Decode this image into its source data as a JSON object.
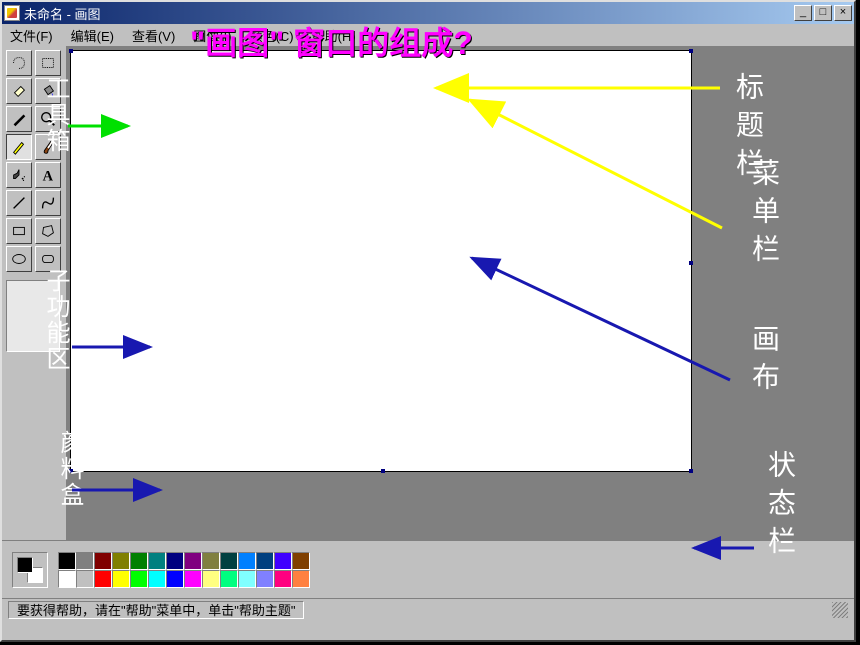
{
  "window": {
    "title": "未命名 - 画图"
  },
  "menu": {
    "file": "文件(F)",
    "edit": "编辑(E)",
    "view": "查看(V)",
    "image": "图像(I)",
    "color": "颜色(C)",
    "help": "帮助(H)"
  },
  "status": {
    "text": "要获得帮助，请在\"帮助\"菜单中，单击\"帮助主题\""
  },
  "annotations": {
    "main_question": "\"画图\" 窗口的组成?",
    "toolbox": "工具箱",
    "sub_options": "子功能区",
    "palette": "颜料盒",
    "title_bar": "标题栏",
    "menu_bar": "菜单栏",
    "canvas": "画布",
    "status_bar": "状态栏"
  },
  "palette_colors": [
    "#000000",
    "#808080",
    "#800000",
    "#808000",
    "#008000",
    "#008080",
    "#000080",
    "#800080",
    "#808040",
    "#004040",
    "#0080ff",
    "#004080",
    "#4000ff",
    "#804000",
    "#ffffff",
    "#c0c0c0",
    "#ff0000",
    "#ffff00",
    "#00ff00",
    "#00ffff",
    "#0000ff",
    "#ff00ff",
    "#ffff80",
    "#00ff80",
    "#80ffff",
    "#8080ff",
    "#ff0080",
    "#ff8040"
  ],
  "arrow_colors": {
    "green": "#00e000",
    "blue": "#1818b0",
    "yellow": "#ffff00"
  }
}
